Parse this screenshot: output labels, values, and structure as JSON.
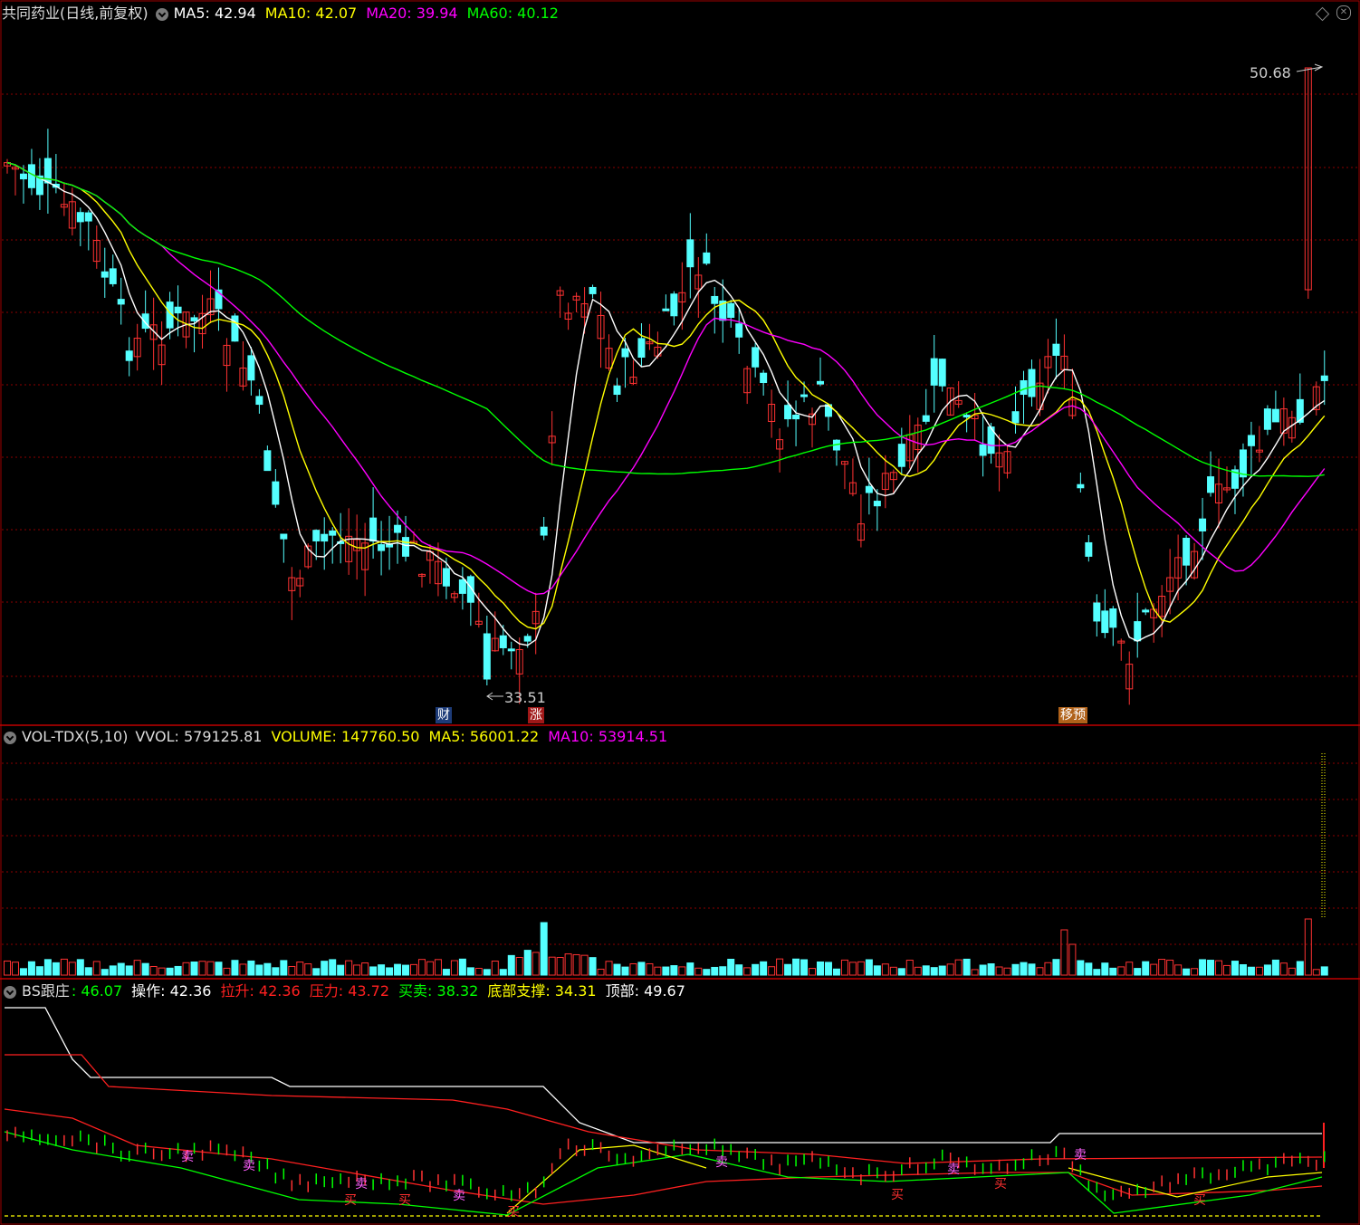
{
  "panels": {
    "price": {
      "title": "共同药业(日线,前复权)",
      "ma5": "MA5: 42.94",
      "ma10": "MA10: 42.07",
      "ma20": "MA20: 39.94",
      "ma60": "MA60: 40.12",
      "high_label": "50.68",
      "low_label": "33.51",
      "event_tags": [
        "财",
        "涨",
        "移预"
      ]
    },
    "volume": {
      "name": "VOL-TDX(5,10)",
      "vvol": "VVOL: 579125.81",
      "volume": "VOLUME: 147760.50",
      "ma5": "MA5: 56001.22",
      "ma10": "MA10: 53914.51"
    },
    "bs": {
      "name": "BS跟庄",
      "val0": ": 46.07",
      "op": "操作: 42.36",
      "lift": "拉升: 42.36",
      "press": "压力: 43.72",
      "buysell": "买卖: 38.32",
      "support": "底部支撑: 34.31",
      "top": "顶部: 49.67",
      "signal_labels": [
        "卖",
        "买"
      ]
    }
  },
  "colors": {
    "up": "#ff3232",
    "down": "#54ffff",
    "ma5": "#ffffff",
    "ma10": "#ffff00",
    "ma20": "#ff00ff",
    "ma60": "#00ff00",
    "grid": "#8b0000"
  },
  "chart_data": [
    {
      "type": "candlestick",
      "title": "共同药业(日线,前复权)",
      "ylim": [
        33.51,
        50.68
      ],
      "annotations": [
        "50.68",
        "33.51"
      ],
      "series": [
        {
          "name": "MA5",
          "last": 42.94
        },
        {
          "name": "MA10",
          "last": 42.07
        },
        {
          "name": "MA20",
          "last": 39.94
        },
        {
          "name": "MA60",
          "last": 40.12
        }
      ]
    },
    {
      "type": "bar",
      "title": "VOL-TDX(5,10)",
      "series": [
        {
          "name": "VOLUME",
          "last": 147760.5
        },
        {
          "name": "MA5",
          "last": 56001.22
        },
        {
          "name": "MA10",
          "last": 53914.51
        }
      ]
    },
    {
      "type": "line",
      "title": "BS跟庄",
      "series": [
        {
          "name": "操作",
          "last": 42.36
        },
        {
          "name": "拉升",
          "last": 42.36
        },
        {
          "name": "压力",
          "last": 43.72
        },
        {
          "name": "买卖",
          "last": 38.32
        },
        {
          "name": "底部支撑",
          "last": 34.31
        },
        {
          "name": "顶部",
          "last": 49.67
        }
      ]
    }
  ]
}
